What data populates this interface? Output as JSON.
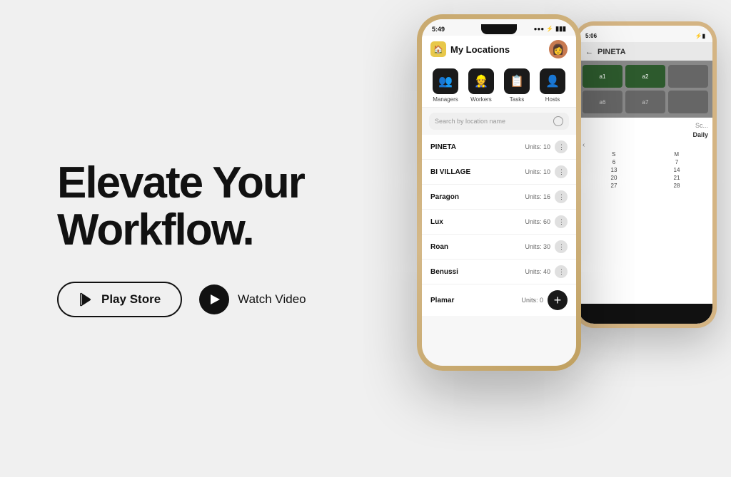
{
  "page": {
    "background": "#f0f0f0"
  },
  "left": {
    "headline_line1": "Elevate Your",
    "headline_line2": "Workflow.",
    "play_store_label": "Play Store",
    "watch_video_label": "Watch Video"
  },
  "app": {
    "status_time": "5:49",
    "title": "My Locations",
    "search_placeholder": "Search by location name",
    "icons": [
      {
        "label": "Managers",
        "emoji": "👥"
      },
      {
        "label": "Workers",
        "emoji": "👷"
      },
      {
        "label": "Tasks",
        "emoji": "📋"
      },
      {
        "label": "Hosts",
        "emoji": "👤"
      }
    ],
    "locations": [
      {
        "name": "PINETA",
        "units": "Units: 10"
      },
      {
        "name": "BI VILLAGE",
        "units": "Units: 10"
      },
      {
        "name": "Paragon",
        "units": "Units: 16"
      },
      {
        "name": "Lux",
        "units": "Units: 60"
      },
      {
        "name": "Roan",
        "units": "Units: 30"
      },
      {
        "name": "Benussi",
        "units": "Units: 40"
      },
      {
        "name": "Plamar",
        "units": "Units: 0"
      }
    ]
  },
  "back_phone": {
    "status_time": "5:06",
    "header_title": "PINETA",
    "daily_label": "Daily",
    "grid_cells": [
      "a1",
      "a2",
      "a6",
      "a7"
    ],
    "cal_rows": [
      [
        "S",
        "M"
      ],
      [
        "6",
        "7"
      ],
      [
        "13",
        "14"
      ],
      [
        "20",
        "21"
      ],
      [
        "27",
        "28"
      ]
    ]
  }
}
